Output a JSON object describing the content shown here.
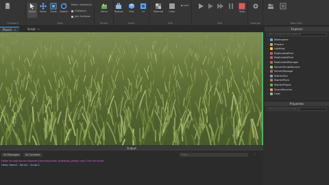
{
  "ribbon": {
    "groups": [
      {
        "label": "Clipboard"
      },
      {
        "label": "Tools"
      },
      {
        "label": "Terrain"
      },
      {
        "label": "Insert"
      },
      {
        "label": "Edit"
      },
      {
        "label": "Test"
      },
      {
        "label": "Settings"
      },
      {
        "label": "Team Test"
      }
    ],
    "tools": {
      "select": "Select",
      "move": "Move",
      "scale": "Scale",
      "rotate": "Rotate",
      "mode": "Mode:",
      "mode_value": "Geometric",
      "collisions": "Collisions",
      "join_surfaces": "Join Surfaces",
      "editor": "Editor",
      "toolbox": "Toolbox",
      "part": "Part",
      "ui": "UI",
      "material": "Material",
      "color": "Color",
      "lock": "Lock",
      "stop": "Stop"
    }
  },
  "tabs": [
    {
      "label": "Place1"
    },
    {
      "label": "Script"
    }
  ],
  "explorer": {
    "title": "Explorer",
    "filter_placeholder": "Filter workspace (Ctrl+Shift+X)",
    "items": [
      {
        "label": "Workspace",
        "color": "#5fa8ff"
      },
      {
        "label": "Players",
        "color": "#e0a050"
      },
      {
        "label": "Lighting",
        "color": "#f0d050"
      },
      {
        "label": "ReplicatedFirst",
        "color": "#c06060"
      },
      {
        "label": "ReplicatedFirst",
        "color": "#c06060"
      },
      {
        "label": "ReplicatedStorage",
        "color": "#c06060"
      },
      {
        "label": "ServerScriptService",
        "color": "#7fd07f"
      },
      {
        "label": "ServerStorage",
        "color": "#c06060"
      },
      {
        "label": "StarterGui",
        "color": "#6fa0e0"
      },
      {
        "label": "StarterPack",
        "color": "#c07f40"
      },
      {
        "label": "StarterPlayer",
        "color": "#60b060"
      },
      {
        "label": "SoundService",
        "color": "#e0a050"
      },
      {
        "label": "Chat",
        "color": "#aaaaaa"
      }
    ]
  },
  "properties": {
    "title": "Properties",
    "filter_placeholder": "Filter Properties (Ctrl+Shift+P)"
  },
  "output": {
    "title": "Output",
    "filters": {
      "messages": "All Messages",
      "contexts": "All Contexts"
    },
    "search_placeholder": "Filter...",
    "lines": [
      {
        "text": "Failed to load sound rbxasset://sounds/action_footsteps_plastic.mp3: File not found",
        "color": "#d070d0"
      },
      {
        "text": "Hello, World!  -  Server - Script:1",
        "color": "#a9c7ff"
      }
    ]
  },
  "colors": {
    "accent": "#3da5ff",
    "viewport_border": "#3cbf5a",
    "stop_button": "#e05a5a"
  }
}
